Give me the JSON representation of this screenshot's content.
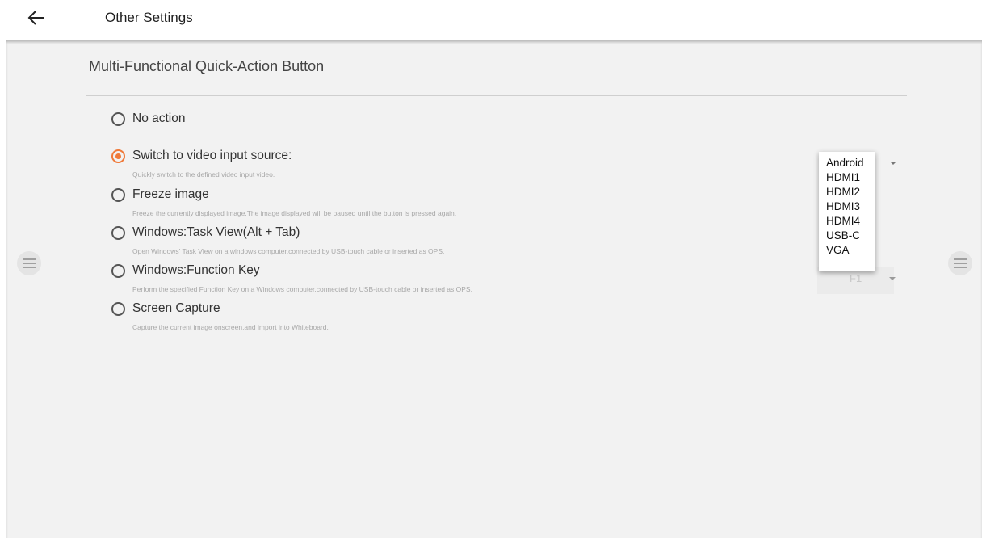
{
  "header": {
    "title": "Other Settings",
    "back_icon": "arrow-left-icon"
  },
  "section": {
    "title": "Multi-Functional Quick-Action Button"
  },
  "accent_color": "#f07a3a",
  "options": [
    {
      "label": "No action",
      "desc": "",
      "checked": false
    },
    {
      "label": "Switch to video input source:",
      "desc": "Quickly switch to the defined video input video.",
      "checked": true
    },
    {
      "label": "Freeze image",
      "desc": "Freeze the currently displayed image.The image displayed will be paused until the button is pressed again.",
      "checked": false
    },
    {
      "label": "Windows:Task View(Alt + Tab)",
      "desc": "Open Windows' Task View on a windows computer,connected by USB-touch cable or inserted as OPS.",
      "checked": false
    },
    {
      "label": "Windows:Function Key",
      "desc": "Perform the specified Function Key on a Windows computer,connected by USB-touch cable or inserted as OPS.",
      "checked": false
    },
    {
      "label": "Screen Capture",
      "desc": "Capture the current image onscreen,and import into Whiteboard.",
      "checked": false
    }
  ],
  "source_dropdown": {
    "selected": "Android",
    "items": [
      "Android",
      "HDMI1",
      "HDMI2",
      "HDMI3",
      "HDMI4",
      "USB-C",
      "VGA"
    ]
  },
  "function_key_select": {
    "value": "F1"
  },
  "side_buttons": {
    "left_icon": "menu-icon",
    "right_icon": "menu-icon"
  }
}
